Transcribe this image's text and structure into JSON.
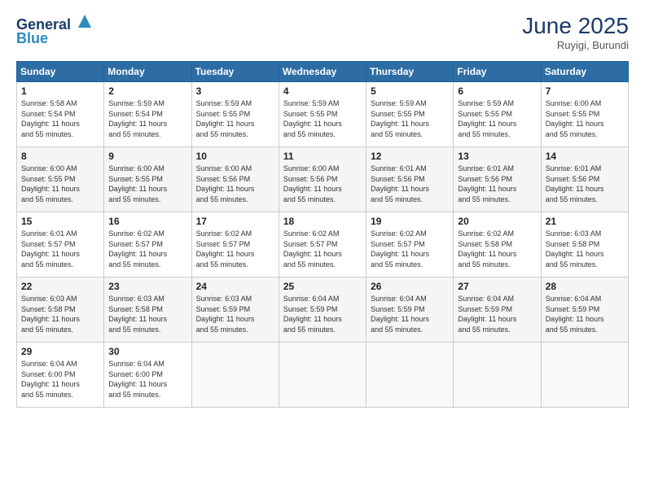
{
  "header": {
    "logo_line1": "General",
    "logo_line2": "Blue",
    "month": "June 2025",
    "location": "Ruyigi, Burundi"
  },
  "days_of_week": [
    "Sunday",
    "Monday",
    "Tuesday",
    "Wednesday",
    "Thursday",
    "Friday",
    "Saturday"
  ],
  "weeks": [
    [
      {
        "day": "1",
        "info": "Sunrise: 5:58 AM\nSunset: 5:54 PM\nDaylight: 11 hours\nand 55 minutes."
      },
      {
        "day": "2",
        "info": "Sunrise: 5:59 AM\nSunset: 5:54 PM\nDaylight: 11 hours\nand 55 minutes."
      },
      {
        "day": "3",
        "info": "Sunrise: 5:59 AM\nSunset: 5:55 PM\nDaylight: 11 hours\nand 55 minutes."
      },
      {
        "day": "4",
        "info": "Sunrise: 5:59 AM\nSunset: 5:55 PM\nDaylight: 11 hours\nand 55 minutes."
      },
      {
        "day": "5",
        "info": "Sunrise: 5:59 AM\nSunset: 5:55 PM\nDaylight: 11 hours\nand 55 minutes."
      },
      {
        "day": "6",
        "info": "Sunrise: 5:59 AM\nSunset: 5:55 PM\nDaylight: 11 hours\nand 55 minutes."
      },
      {
        "day": "7",
        "info": "Sunrise: 6:00 AM\nSunset: 5:55 PM\nDaylight: 11 hours\nand 55 minutes."
      }
    ],
    [
      {
        "day": "8",
        "info": "Sunrise: 6:00 AM\nSunset: 5:55 PM\nDaylight: 11 hours\nand 55 minutes."
      },
      {
        "day": "9",
        "info": "Sunrise: 6:00 AM\nSunset: 5:55 PM\nDaylight: 11 hours\nand 55 minutes."
      },
      {
        "day": "10",
        "info": "Sunrise: 6:00 AM\nSunset: 5:56 PM\nDaylight: 11 hours\nand 55 minutes."
      },
      {
        "day": "11",
        "info": "Sunrise: 6:00 AM\nSunset: 5:56 PM\nDaylight: 11 hours\nand 55 minutes."
      },
      {
        "day": "12",
        "info": "Sunrise: 6:01 AM\nSunset: 5:56 PM\nDaylight: 11 hours\nand 55 minutes."
      },
      {
        "day": "13",
        "info": "Sunrise: 6:01 AM\nSunset: 5:56 PM\nDaylight: 11 hours\nand 55 minutes."
      },
      {
        "day": "14",
        "info": "Sunrise: 6:01 AM\nSunset: 5:56 PM\nDaylight: 11 hours\nand 55 minutes."
      }
    ],
    [
      {
        "day": "15",
        "info": "Sunrise: 6:01 AM\nSunset: 5:57 PM\nDaylight: 11 hours\nand 55 minutes."
      },
      {
        "day": "16",
        "info": "Sunrise: 6:02 AM\nSunset: 5:57 PM\nDaylight: 11 hours\nand 55 minutes."
      },
      {
        "day": "17",
        "info": "Sunrise: 6:02 AM\nSunset: 5:57 PM\nDaylight: 11 hours\nand 55 minutes."
      },
      {
        "day": "18",
        "info": "Sunrise: 6:02 AM\nSunset: 5:57 PM\nDaylight: 11 hours\nand 55 minutes."
      },
      {
        "day": "19",
        "info": "Sunrise: 6:02 AM\nSunset: 5:57 PM\nDaylight: 11 hours\nand 55 minutes."
      },
      {
        "day": "20",
        "info": "Sunrise: 6:02 AM\nSunset: 5:58 PM\nDaylight: 11 hours\nand 55 minutes."
      },
      {
        "day": "21",
        "info": "Sunrise: 6:03 AM\nSunset: 5:58 PM\nDaylight: 11 hours\nand 55 minutes."
      }
    ],
    [
      {
        "day": "22",
        "info": "Sunrise: 6:03 AM\nSunset: 5:58 PM\nDaylight: 11 hours\nand 55 minutes."
      },
      {
        "day": "23",
        "info": "Sunrise: 6:03 AM\nSunset: 5:58 PM\nDaylight: 11 hours\nand 55 minutes."
      },
      {
        "day": "24",
        "info": "Sunrise: 6:03 AM\nSunset: 5:59 PM\nDaylight: 11 hours\nand 55 minutes."
      },
      {
        "day": "25",
        "info": "Sunrise: 6:04 AM\nSunset: 5:59 PM\nDaylight: 11 hours\nand 55 minutes."
      },
      {
        "day": "26",
        "info": "Sunrise: 6:04 AM\nSunset: 5:59 PM\nDaylight: 11 hours\nand 55 minutes."
      },
      {
        "day": "27",
        "info": "Sunrise: 6:04 AM\nSunset: 5:59 PM\nDaylight: 11 hours\nand 55 minutes."
      },
      {
        "day": "28",
        "info": "Sunrise: 6:04 AM\nSunset: 5:59 PM\nDaylight: 11 hours\nand 55 minutes."
      }
    ],
    [
      {
        "day": "29",
        "info": "Sunrise: 6:04 AM\nSunset: 6:00 PM\nDaylight: 11 hours\nand 55 minutes."
      },
      {
        "day": "30",
        "info": "Sunrise: 6:04 AM\nSunset: 6:00 PM\nDaylight: 11 hours\nand 55 minutes."
      },
      {
        "day": "",
        "info": ""
      },
      {
        "day": "",
        "info": ""
      },
      {
        "day": "",
        "info": ""
      },
      {
        "day": "",
        "info": ""
      },
      {
        "day": "",
        "info": ""
      }
    ]
  ]
}
